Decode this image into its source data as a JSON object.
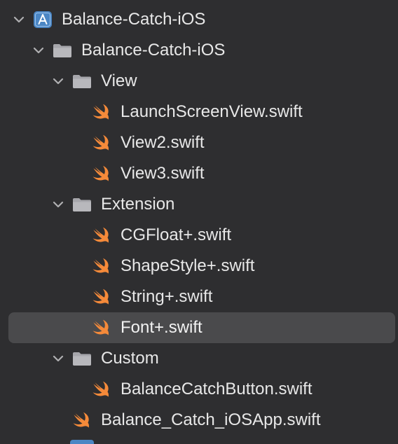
{
  "colors": {
    "background": "#2e2e30",
    "selection": "#4a4a4c",
    "text": "#e8e8e8",
    "chevron": "#b0b0b2",
    "folder": "#a6a6ab",
    "swift_orange": "#f58a3a",
    "project_blue": "#4b86c4"
  },
  "tree": [
    {
      "label": "Balance-Catch-iOS",
      "icon": "project-icon",
      "level": 0,
      "expanded": true
    },
    {
      "label": "Balance-Catch-iOS",
      "icon": "folder-icon",
      "level": 1,
      "expanded": true
    },
    {
      "label": "View",
      "icon": "folder-icon",
      "level": 2,
      "expanded": true
    },
    {
      "label": "LaunchScreenView.swift",
      "icon": "swift-file-icon",
      "level": 3
    },
    {
      "label": "View2.swift",
      "icon": "swift-file-icon",
      "level": 3
    },
    {
      "label": "View3.swift",
      "icon": "swift-file-icon",
      "level": 3
    },
    {
      "label": "Extension",
      "icon": "folder-icon",
      "level": 2,
      "expanded": true
    },
    {
      "label": "CGFloat+.swift",
      "icon": "swift-file-icon",
      "level": 3
    },
    {
      "label": "ShapeStyle+.swift",
      "icon": "swift-file-icon",
      "level": 3
    },
    {
      "label": "String+.swift",
      "icon": "swift-file-icon",
      "level": 3
    },
    {
      "label": "Font+.swift",
      "icon": "swift-file-icon",
      "level": 3,
      "selected": true
    },
    {
      "label": "Custom",
      "icon": "folder-icon",
      "level": 2,
      "expanded": true
    },
    {
      "label": "BalanceCatchButton.swift",
      "icon": "swift-file-icon",
      "level": 3
    },
    {
      "label": "Balance_Catch_iOSApp.swift",
      "icon": "swift-file-icon",
      "level": 2
    }
  ]
}
